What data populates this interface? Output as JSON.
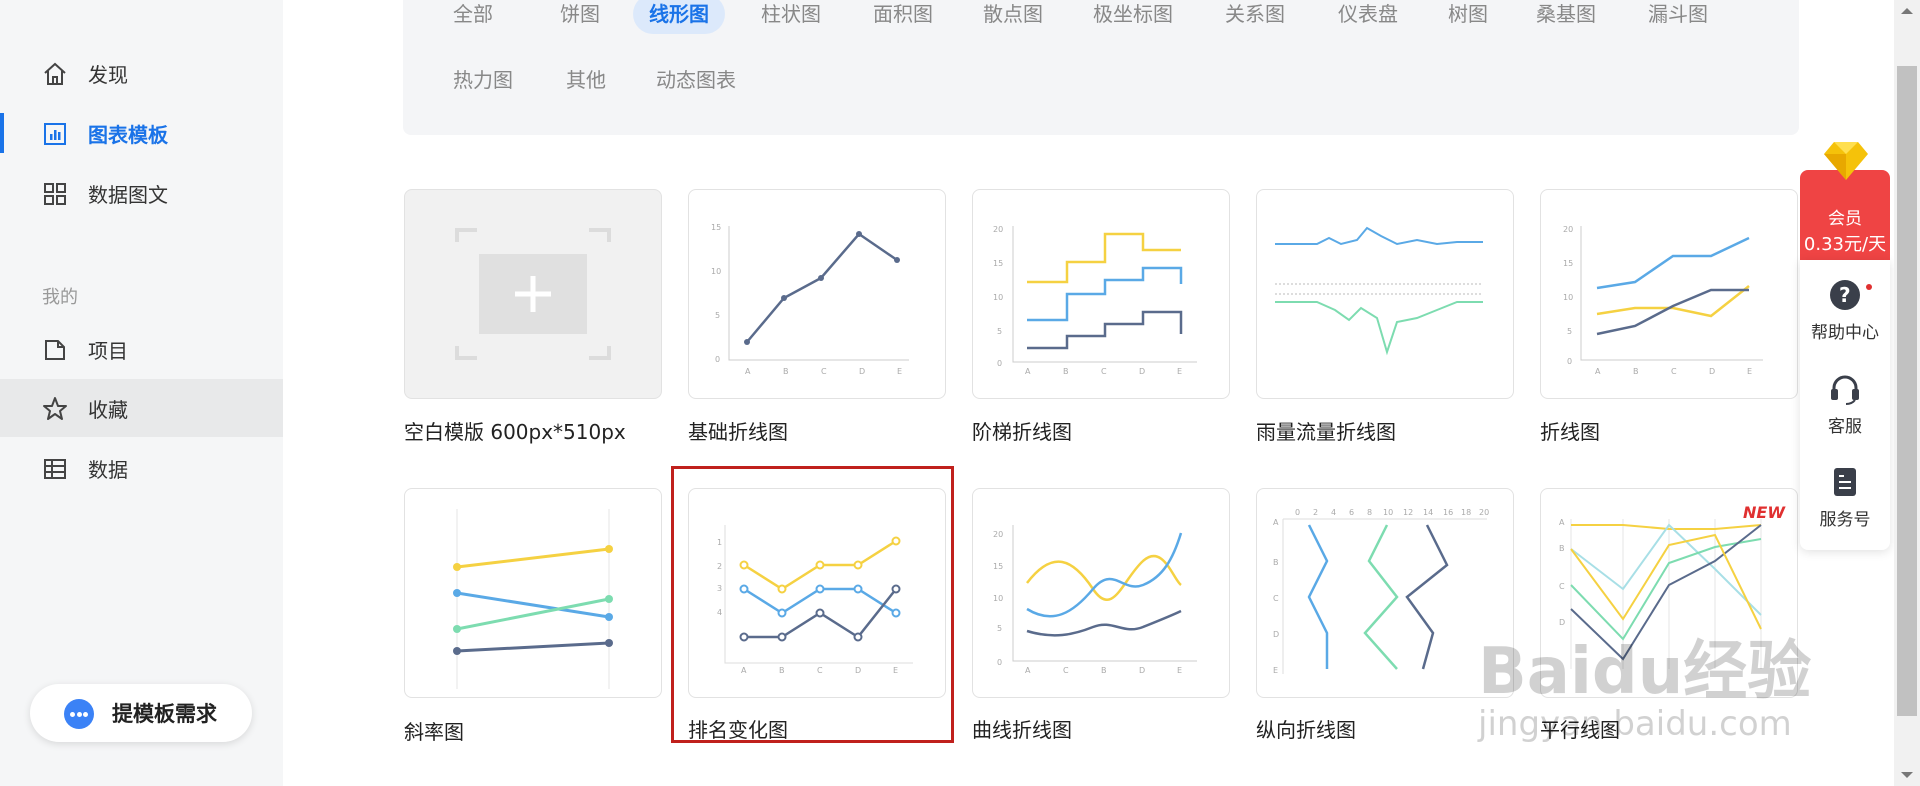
{
  "sidebar": {
    "nav": [
      {
        "label": "发现",
        "icon": "home-icon"
      },
      {
        "label": "图表模板",
        "icon": "chart-template-icon"
      },
      {
        "label": "数据图文",
        "icon": "grid-icon"
      }
    ],
    "section_title": "我的",
    "my_items": [
      {
        "label": "项目",
        "icon": "folder-icon"
      },
      {
        "label": "收藏",
        "icon": "star-icon"
      },
      {
        "label": "数据",
        "icon": "table-icon"
      }
    ],
    "request_button": "提模板需求"
  },
  "filters": {
    "row1": [
      "全部",
      "饼图",
      "线形图",
      "柱状图",
      "面积图",
      "散点图",
      "极坐标图",
      "关系图",
      "仪表盘",
      "树图",
      "桑基图",
      "漏斗图"
    ],
    "row2": [
      "热力图",
      "其他",
      "动态图表"
    ],
    "active": "线形图"
  },
  "cards": [
    {
      "label": "空白模版 600px*510px"
    },
    {
      "label": "基础折线图"
    },
    {
      "label": "阶梯折线图"
    },
    {
      "label": "雨量流量折线图"
    },
    {
      "label": "折线图"
    },
    {
      "label": "斜率图"
    },
    {
      "label": "排名变化图"
    },
    {
      "label": "曲线折线图"
    },
    {
      "label": "纵向折线图"
    },
    {
      "label": "平行线图",
      "badge": "NEW"
    }
  ],
  "float_panel": {
    "vip_line1": "会员",
    "vip_line2": "0.33元/天",
    "help": "帮助中心",
    "service": "客服",
    "account": "服务号"
  },
  "watermark": {
    "brand": "Baidu经验",
    "url": "jingyan.baidu.com"
  },
  "colors": {
    "accent": "#1a73e8",
    "selection": "#c0201c",
    "vip": "#ef4444"
  }
}
